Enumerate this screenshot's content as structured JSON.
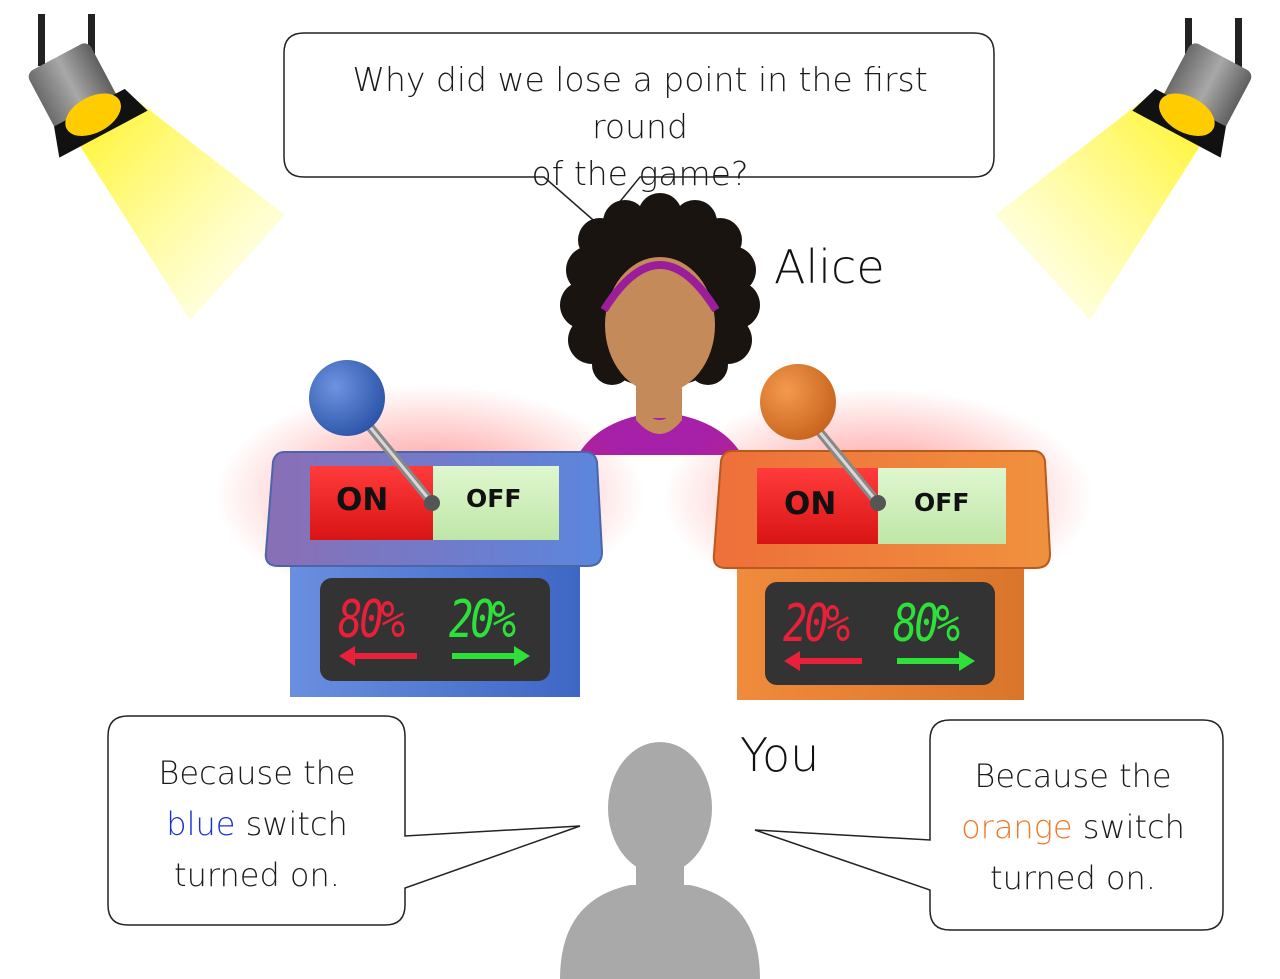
{
  "question": {
    "line1": "Why did we lose a point in the first round",
    "line2": "of the game?"
  },
  "alice": {
    "name": "Alice"
  },
  "you": {
    "name": "You"
  },
  "blue_console": {
    "color": "#5a86d8",
    "on_label": "ON",
    "off_label": "OFF",
    "left_percent": "80%",
    "right_percent": "20%"
  },
  "orange_console": {
    "color": "#ef8a3c",
    "on_label": "ON",
    "off_label": "OFF",
    "left_percent": "20%",
    "right_percent": "80%"
  },
  "answer_blue": {
    "line1": "Because the",
    "colored_word": "blue",
    "rest": " switch",
    "line3": "turned on.",
    "color": "#1a2fd6"
  },
  "answer_orange": {
    "line1": "Because the",
    "colored_word": "orange",
    "rest": " switch",
    "line3": "turned on.",
    "color": "#ee7a2a"
  },
  "colors": {
    "display_red": "#e8203a",
    "display_green": "#2ee03a",
    "spotlight_beam": "#ffef2a"
  }
}
